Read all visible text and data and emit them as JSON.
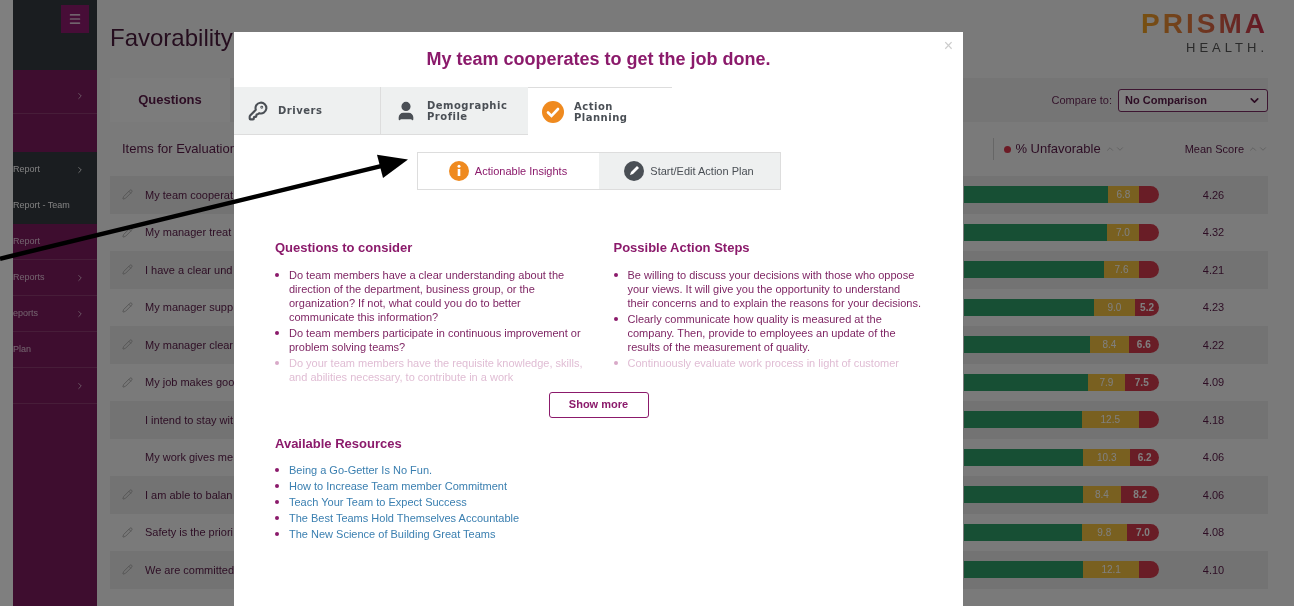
{
  "sidebar": {
    "items": [
      {
        "chevron": true,
        "highlighted": false
      },
      {
        "label": "Report",
        "chevron": true,
        "highlighted": true
      },
      {
        "label": "Report - Team",
        "chevron": false,
        "highlighted": true
      },
      {
        "label": "Report",
        "chevron": false,
        "highlighted": false
      },
      {
        "label": "Reports",
        "chevron": true,
        "highlighted": false
      },
      {
        "label": "eports",
        "chevron": true,
        "highlighted": false
      },
      {
        "label": "Plan",
        "chevron": false,
        "highlighted": false
      },
      {
        "chevron": true,
        "highlighted": false
      }
    ]
  },
  "page": {
    "title": "Favorability",
    "logo": {
      "name": "PRISMA",
      "sub": "HEALTH."
    }
  },
  "toolbar": {
    "tab": "Questions",
    "compare_label": "Compare to:",
    "compare_value": "No Comparison"
  },
  "table": {
    "columns": {
      "items": "Items for Evaluation",
      "unfavorable": "% Unfavorable",
      "mean": "Mean Score"
    },
    "rows": [
      {
        "text": "My team cooperat",
        "editable": true,
        "neutral": "6.8",
        "mean": "4.26"
      },
      {
        "text": "My manager treat",
        "editable": true,
        "neutral": "7.0",
        "mean": "4.32"
      },
      {
        "text": "I have a clear und",
        "editable": true,
        "neutral": "7.6",
        "mean": "4.21"
      },
      {
        "text": "My manager supp",
        "editable": true,
        "neutral": "9.0",
        "unfavorable": "5.2",
        "mean": "4.23"
      },
      {
        "text": "My manager clear",
        "editable": true,
        "neutral": "8.4",
        "unfavorable": "6.6",
        "mean": "4.22"
      },
      {
        "text": "My job makes goo",
        "editable": true,
        "neutral": "7.9",
        "unfavorable": "7.5",
        "mean": "4.09"
      },
      {
        "text": "I intend to stay wit",
        "editable": false,
        "neutral": "12.5",
        "mean": "4.18"
      },
      {
        "text": "My work gives me",
        "editable": false,
        "neutral": "10.3",
        "unfavorable": "6.2",
        "mean": "4.06"
      },
      {
        "text": "I am able to balan",
        "editable": true,
        "neutral": "8.4",
        "unfavorable": "8.2",
        "mean": "4.06"
      },
      {
        "text": "Safety is the priori",
        "editable": true,
        "neutral": "9.8",
        "unfavorable": "7.0",
        "mean": "4.08"
      },
      {
        "text": "We are committed",
        "editable": true,
        "neutral": "12.1",
        "mean": "4.10"
      }
    ]
  },
  "modal": {
    "title": "My team cooperates to get the job done.",
    "close": "×",
    "tabs": [
      {
        "label": "Drivers",
        "selected": false
      },
      {
        "label": "Demographic Profile",
        "selected": false
      },
      {
        "label": "Action Planning",
        "selected": true
      }
    ],
    "subtabs": [
      {
        "label": "Actionable Insights",
        "selected": true
      },
      {
        "label": "Start/Edit Action Plan",
        "selected": false
      }
    ],
    "questions": {
      "heading": "Questions to consider",
      "items": [
        {
          "text": "Do team members have a clear understanding about the direction of the department, business group, or the organization? If not, what could you do to better communicate this information?",
          "faded": false
        },
        {
          "text": "Do team members participate in continuous improvement or problem solving teams?",
          "faded": false
        },
        {
          "text": "Do your team members have the requisite knowledge, skills, and abilities necessary, to contribute in a work",
          "faded": true
        }
      ]
    },
    "actions": {
      "heading": "Possible Action Steps",
      "items": [
        {
          "text": "Be willing to discuss your decisions with those who oppose your views. It will give you the opportunity to understand their concerns and to explain the reasons for your decisions.",
          "faded": false
        },
        {
          "text": "Clearly communicate how quality is measured at the company. Then, provide to employees an update of the results of the measurement of quality.",
          "faded": false
        },
        {
          "text": "Continuously evaluate work process in light of customer",
          "faded": true
        }
      ]
    },
    "show_more": "Show more",
    "resources": {
      "heading": "Available Resources",
      "links": [
        "Being a Go-Getter Is No Fun.",
        "How to Increase Team member Commitment",
        "Teach Your Team to Expect Success",
        "The Best Teams Hold Themselves Accountable",
        "The New Science of Building Great Teams"
      ]
    }
  }
}
